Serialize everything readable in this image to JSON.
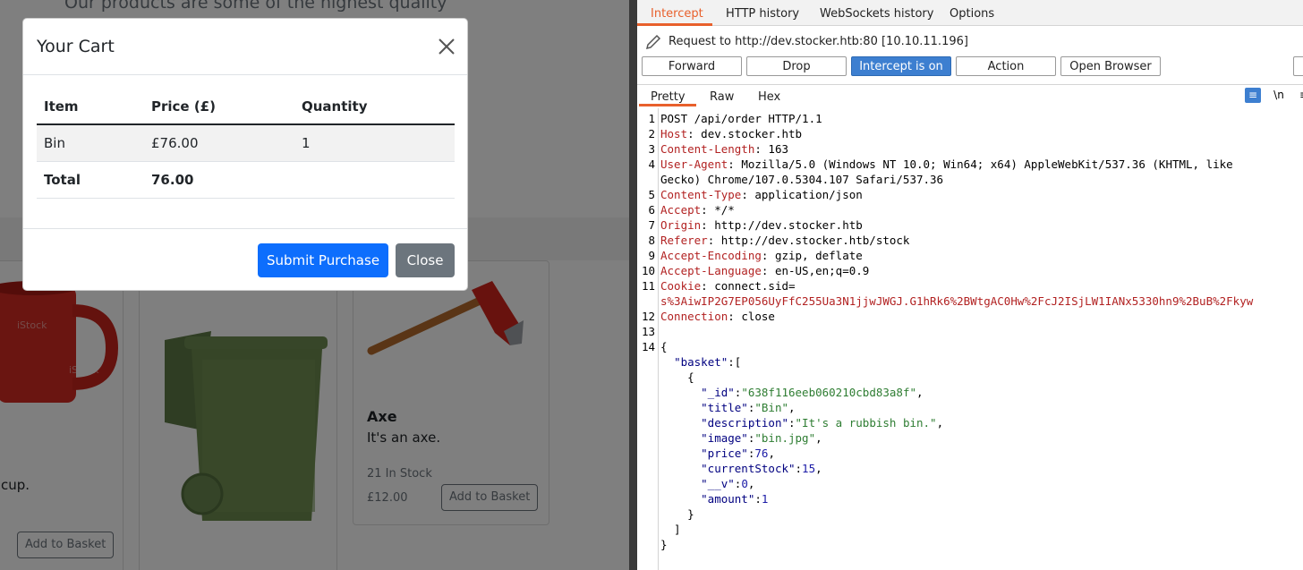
{
  "shop": {
    "tagline": "Our products are some of the highest quality",
    "products": [
      {
        "desc_partial": "cup.",
        "button": "Add to Basket"
      },
      {
        "name": "Axe",
        "description": "It's an axe.",
        "stock": "21 In Stock",
        "price": "£12.00",
        "button": "Add to Basket"
      }
    ]
  },
  "modal": {
    "title": "Your Cart",
    "headers": [
      "Item",
      "Price (£)",
      "Quantity"
    ],
    "rows": [
      [
        "Bin",
        "£76.00",
        "1"
      ]
    ],
    "total_label": "Total",
    "total_value": "76.00",
    "submit_label": "Submit Purchase",
    "close_label": "Close"
  },
  "burp": {
    "tabs": [
      "Intercept",
      "HTTP history",
      "WebSockets history",
      "Options"
    ],
    "request_line": "Request to http://dev.stocker.htb:80  [10.10.11.196]",
    "buttons": {
      "forward": "Forward",
      "drop": "Drop",
      "intercept": "Intercept is on",
      "action": "Action",
      "open_browser": "Open Browser"
    },
    "view_tabs": [
      "Pretty",
      "Raw",
      "Hex"
    ],
    "icons": {
      "wrap": "wrap-icon",
      "newline": "\\n",
      "menu": "menu-icon"
    },
    "lines": [
      {
        "n": "1",
        "text": "POST /api/order HTTP/1.1"
      },
      {
        "n": "2",
        "key": "Host",
        "val": " dev.stocker.htb"
      },
      {
        "n": "3",
        "key": "Content-Length",
        "val": " 163"
      },
      {
        "n": "4",
        "key": "User-Agent",
        "val": " Mozilla/5.0 (Windows NT 10.0; Win64; x64) AppleWebKit/537.36 (KHTML, like"
      },
      {
        "n": "",
        "text": "Gecko) Chrome/107.0.5304.107 Safari/537.36"
      },
      {
        "n": "5",
        "key": "Content-Type",
        "val": " application/json"
      },
      {
        "n": "6",
        "key": "Accept",
        "val": " */*"
      },
      {
        "n": "7",
        "key": "Origin",
        "val": " http://dev.stocker.htb"
      },
      {
        "n": "8",
        "key": "Referer",
        "val": " http://dev.stocker.htb/stock"
      },
      {
        "n": "9",
        "key": "Accept-Encoding",
        "val": " gzip, deflate"
      },
      {
        "n": "10",
        "key": "Accept-Language",
        "val": " en-US,en;q=0.9"
      },
      {
        "n": "11",
        "key": "Cookie",
        "val": " connect.sid="
      },
      {
        "n": "",
        "cookie": "s%3AiwIP2G7EP056UyFfC255Ua3N1jjwJWGJ.G1hRk6%2BWtgAC0Hw%2FcJ2ISjLW1IANx5330hn9%2BuB%2Fkyw"
      },
      {
        "n": "12",
        "key": "Connection",
        "val": " close"
      },
      {
        "n": "13",
        "text": ""
      },
      {
        "n": "14",
        "text": "{"
      },
      {
        "n": "",
        "indent": "  ",
        "jk": "\"basket\"",
        "rest": ":["
      },
      {
        "n": "",
        "text": "    {"
      },
      {
        "n": "",
        "indent": "      ",
        "jk": "\"_id\"",
        "rest": ":",
        "js": "\"638f116eeb060210cbd83a8f\"",
        "tail": ","
      },
      {
        "n": "",
        "indent": "      ",
        "jk": "\"title\"",
        "rest": ":",
        "js": "\"Bin\"",
        "tail": ","
      },
      {
        "n": "",
        "indent": "      ",
        "jk": "\"description\"",
        "rest": ":",
        "js": "\"It's a rubbish bin.\"",
        "tail": ","
      },
      {
        "n": "",
        "indent": "      ",
        "jk": "\"image\"",
        "rest": ":",
        "js": "\"bin.jpg\"",
        "tail": ","
      },
      {
        "n": "",
        "indent": "      ",
        "jk": "\"price\"",
        "rest": ":",
        "jn": "76",
        "tail": ","
      },
      {
        "n": "",
        "indent": "      ",
        "jk": "\"currentStock\"",
        "rest": ":",
        "jn": "15",
        "tail": ","
      },
      {
        "n": "",
        "indent": "      ",
        "jk": "\"__v\"",
        "rest": ":",
        "jn": "0",
        "tail": ","
      },
      {
        "n": "",
        "indent": "      ",
        "jk": "\"amount\"",
        "rest": ":",
        "jn": "1",
        "tail": ""
      },
      {
        "n": "",
        "text": "    }"
      },
      {
        "n": "",
        "text": "  ]"
      },
      {
        "n": "",
        "text": "}"
      }
    ]
  },
  "colors": {
    "accent": "#e8602c",
    "primary": "#0d6efd",
    "secondary": "#6c757d",
    "burp_blue": "#3d7fd0"
  }
}
